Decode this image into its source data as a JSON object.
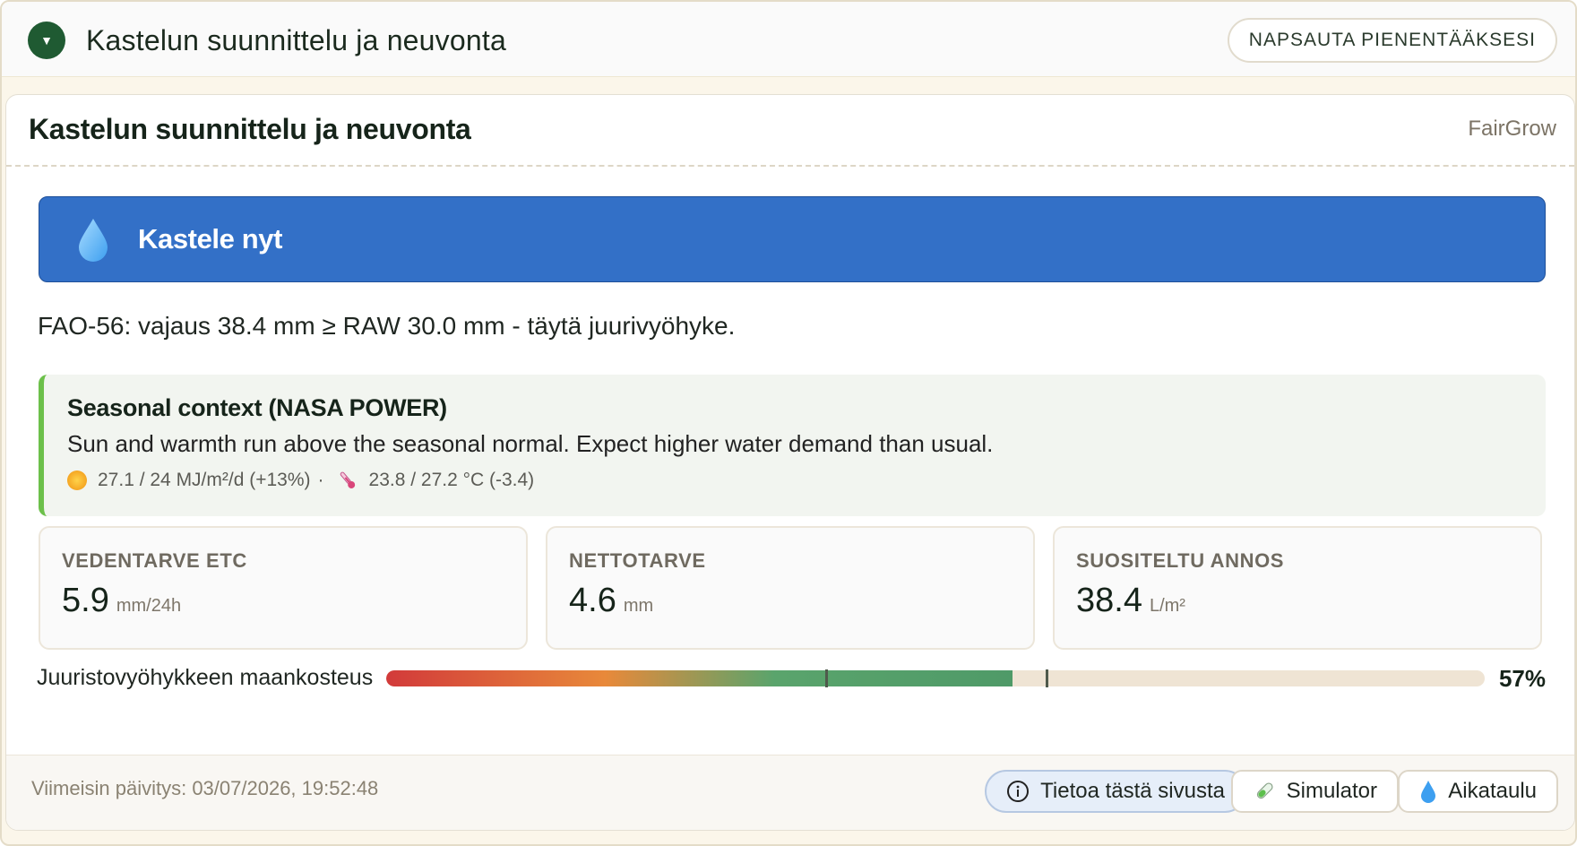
{
  "outer_header": {
    "title": "Kastelun suunnittelu ja neuvonta",
    "minimize_label": "NAPSAUTA PIENENTÄÄKSESI"
  },
  "card": {
    "title": "Kastelun suunnittelu ja neuvonta",
    "brand": "FairGrow"
  },
  "banner": {
    "label": "Kastele nyt",
    "color": "#3370c7"
  },
  "fao_text": "FAO-56: vajaus 38.4 mm ≥ RAW 30.0 mm - täytä juurivyöhyke.",
  "seasonal": {
    "title": "Seasonal context (NASA POWER)",
    "description": "Sun and warmth run above the seasonal normal. Expect higher water demand than usual.",
    "solar": "27.1 / 24 MJ/m²/d (+13%)",
    "separator": "·",
    "temperature": "23.8 / 27.2 °C (-3.4)",
    "accent_color": "#6cc04a"
  },
  "metrics": [
    {
      "label": "VEDENTARVE ETC",
      "value": "5.9",
      "unit": "mm/24h"
    },
    {
      "label": "NETTOTARVE",
      "value": "4.6",
      "unit": "mm"
    },
    {
      "label": "SUOSITELTU ANNOS",
      "value": "38.4",
      "unit": "L/m²"
    }
  ],
  "moisture": {
    "label": "Juuristovyöhykkeen maankosteus",
    "percent_text": "57%",
    "fill_fraction": 0.57,
    "markers": [
      0.4,
      0.6
    ]
  },
  "footer": {
    "updated": "Viimeisin päivitys: 03/07/2026, 19:52:48",
    "info_label": "Tietoa tästä sivusta",
    "simulator_label": "Simulator",
    "schedule_label": "Aikataulu"
  },
  "icons": {
    "toggle": "chevron-down-icon",
    "banner": "water-drop-icon",
    "sun": "sun-icon",
    "thermometer": "thermometer-icon",
    "info": "info-icon",
    "simulator": "test-tube-icon",
    "schedule": "water-drop-icon"
  }
}
